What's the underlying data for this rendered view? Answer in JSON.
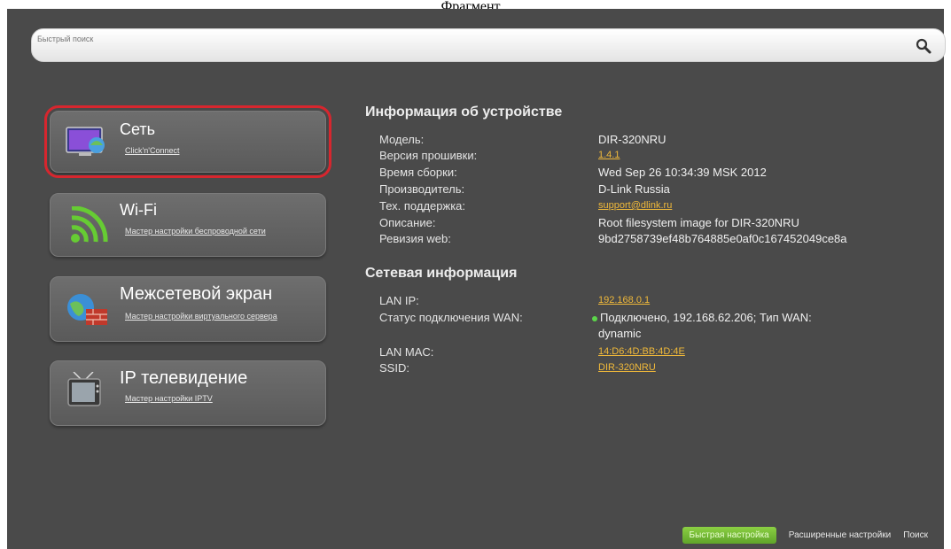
{
  "header_strip_text": "Фрагмент...",
  "search": {
    "placeholder": "Быстрый поиск"
  },
  "tiles": [
    {
      "title": "Сеть",
      "subtitle": "Click'n'Connect",
      "icon": "network-monitor-icon",
      "selected": true
    },
    {
      "title": "Wi-Fi",
      "subtitle": "Мастер настройки беспроводной сети",
      "icon": "wifi-icon",
      "selected": false
    },
    {
      "title": "Межсетевой экран",
      "subtitle": "Мастер настройки виртуального сервера",
      "icon": "firewall-globe-icon",
      "selected": false
    },
    {
      "title": "IP телевидение",
      "subtitle": "Мастер настройки IPTV",
      "icon": "tv-icon",
      "selected": false
    }
  ],
  "device_info": {
    "heading": "Информация об устройстве",
    "rows": [
      {
        "label": "Модель:",
        "value": "DIR-320NRU"
      },
      {
        "label": "Версия прошивки:",
        "value": "1.4.1"
      },
      {
        "label": "Время сборки:",
        "value": "Wed Sep 26 10:34:39 MSK 2012"
      },
      {
        "label": "Производитель:",
        "value": "D-Link Russia"
      },
      {
        "label": "Тех. поддержка:",
        "value": "support@dlink.ru"
      },
      {
        "label": "Описание:",
        "value": "Root filesystem image for DIR-320NRU"
      },
      {
        "label": "Ревизия web:",
        "value": "9bd2758739ef48b764885e0af0c167452049ce8a"
      }
    ]
  },
  "network_info": {
    "heading": "Сетевая информация",
    "rows": [
      {
        "label": "LAN IP:",
        "value": "192.168.0.1"
      },
      {
        "label": "Статус подключения WAN:",
        "value": "Подключено, 192.168.62.206; Тип WAN:",
        "value2": "dynamic"
      },
      {
        "label": "LAN MAC:",
        "value": "14:D6:4D:BB:4D:4E"
      },
      {
        "label": "SSID:",
        "value": "DIR-320NRU"
      }
    ]
  },
  "bottom": {
    "quick_setup": "Быстрая настройка",
    "advanced": "Расширенные настройки",
    "search": "Поиск"
  },
  "colors": {
    "background": "#4a4a4a",
    "link": "#f0b93a",
    "selection": "#d7262e",
    "quick_button": "#6fb233",
    "status_ok": "#5cd64a"
  }
}
